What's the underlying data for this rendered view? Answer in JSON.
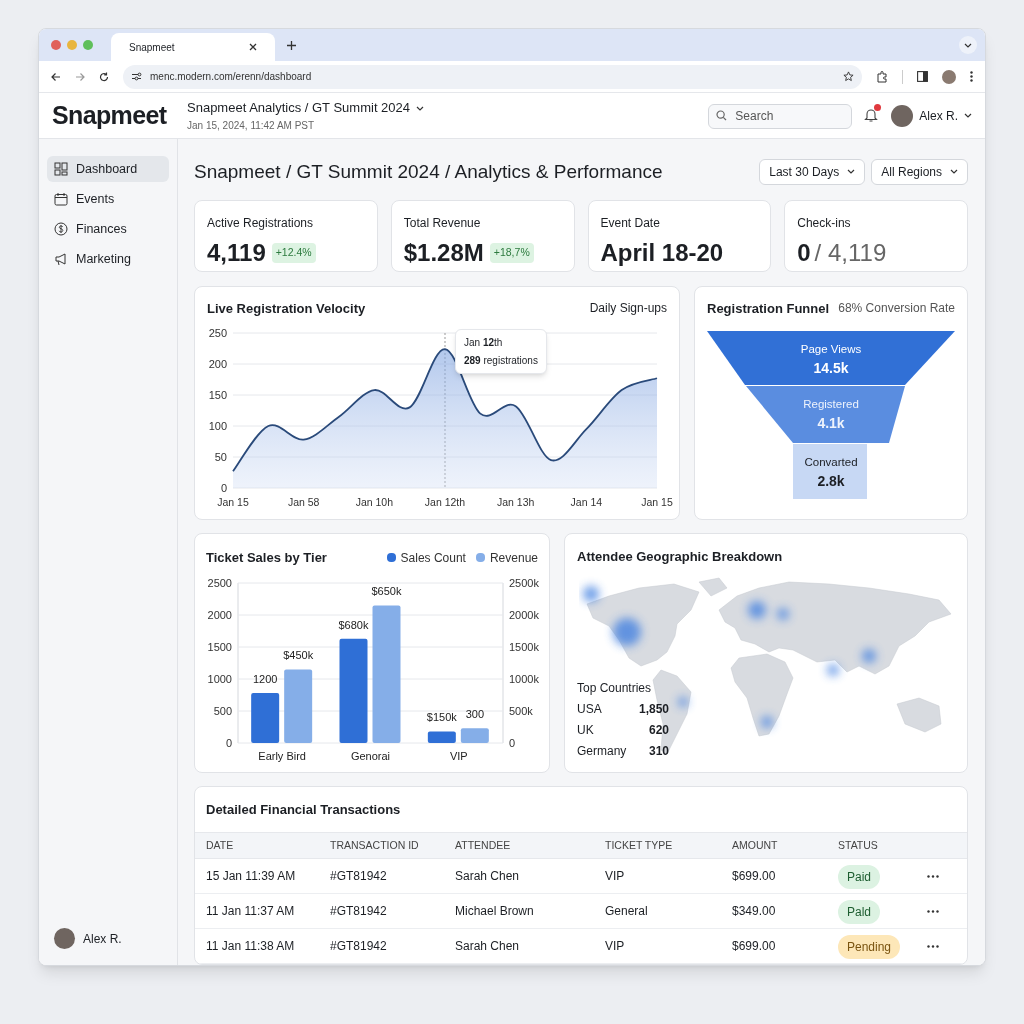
{
  "browser": {
    "tab_title": "Snapmeet",
    "url": "menc.modern.com/erenn/dashboard"
  },
  "header": {
    "logo": "Snapmeet",
    "breadcrumb": "Snapmeet Analytics / GT Summit 2024",
    "timestamp": "Jan 15, 2024, 11:42 AM PST",
    "search": {
      "placeholder": "Search"
    },
    "notifications": true,
    "user": "Alex R."
  },
  "sidebar": {
    "items": [
      {
        "label": "Dashboard",
        "selected": true
      },
      {
        "label": "Events",
        "selected": false
      },
      {
        "label": "Finances",
        "selected": false
      },
      {
        "label": "Marketing",
        "selected": false
      }
    ],
    "user": "Alex R."
  },
  "page": {
    "title": "Snapmeet / GT Summit 2024 / Analytics & Performance",
    "filters": [
      "Last 30 Days",
      "All Regions"
    ]
  },
  "stats": [
    {
      "label": "Active Registrations",
      "value": "4,119",
      "change": "+12.4%"
    },
    {
      "label": "Total Revenue",
      "value": "$1.28M",
      "change": "+18,7%"
    },
    {
      "label": "Event Date",
      "value": "April 18-20"
    },
    {
      "label": "Check-ins",
      "value": "0",
      "total": "/ 4,119"
    }
  ],
  "velocity": {
    "title": "Live Registration Velocity",
    "tooltip": {
      "date": "Jan **12**th",
      "text": "**289** registrations"
    },
    "chart_data": {
      "type": "area",
      "categories": [
        "Jan 15",
        null,
        "Jan 58",
        null,
        "Jan 10h",
        null,
        "Jan 12th",
        null,
        "Jan 13h",
        null,
        "Jan 14",
        null,
        "Jan 15"
      ],
      "series": [
        {
          "name": "Daily Sign-ups",
          "color": "#2a4a7a",
          "values": [
            27,
            100,
            78,
            115,
            158,
            130,
            224,
            120,
            132,
            45,
            95,
            158,
            177
          ]
        }
      ],
      "ylim": [
        0,
        250
      ],
      "grid": true,
      "ref_lines": [
        {
          "axis": "x",
          "value": "Jan 12th"
        }
      ],
      "yticks": [
        0,
        50,
        100,
        150,
        200,
        250
      ]
    }
  },
  "funnel": {
    "title": "Registration Funnel",
    "subtitle": "68% Conversion Rate",
    "stages": [
      {
        "label": "Page Views",
        "value": "14.5k"
      },
      {
        "label": "Registered",
        "value": "4.1k"
      },
      {
        "label": "Convarted",
        "value": "2.8k"
      }
    ]
  },
  "tiers": {
    "title": "Ticket Sales by Tier",
    "chart_data": {
      "type": "bar",
      "categories": [
        "Early Bird",
        "Genorai",
        "VIP"
      ],
      "series": [
        {
          "name": "Sales Count",
          "color": "#2f6fd6",
          "values": [
            780,
            1630,
            180
          ]
        },
        {
          "name": "Revenue",
          "color": "#85aee8",
          "values": [
            1150,
            2150,
            230
          ]
        }
      ],
      "ylim": [
        0,
        2500
      ],
      "y2lim": [
        0,
        2500
      ],
      "grid": true,
      "yticks": [
        0,
        500,
        1000,
        1500,
        2000,
        2500
      ],
      "y2ticks": [
        {
          "value": 0,
          "label": "0"
        },
        {
          "value": 500,
          "label": "500k"
        },
        {
          "value": 1000,
          "label": "1000k"
        },
        {
          "value": 1500,
          "label": "1500k"
        },
        {
          "value": 2000,
          "label": "2000k"
        },
        {
          "value": 2500,
          "label": "2500k"
        }
      ],
      "value_labels": [
        [
          "1200",
          "$680k",
          "$150k"
        ],
        [
          "$450k",
          "$650k",
          "300"
        ]
      ]
    }
  },
  "geo": {
    "title": "Attendee Geographic Breakdown",
    "list_title": "Top Countries",
    "countries": [
      {
        "name": "USA",
        "count": "1,850"
      },
      {
        "name": "UK",
        "count": "620"
      },
      {
        "name": "Germany",
        "count": "310"
      }
    ]
  },
  "transactions": {
    "title": "Detailed Financial Transactions",
    "columns": [
      "DATE",
      "TRANSACTION ID",
      "ATTENDEE",
      "TICKET TYPE",
      "AMOUNT",
      "STATUS"
    ],
    "rows": [
      {
        "date": "15 Jan 11:39 AM",
        "id": "#GT81942",
        "attendee": "Sarah Chen",
        "ticket": "VIP",
        "amount": "$699.00",
        "status": "Paid",
        "kind": "paid"
      },
      {
        "date": "11 Jan 11:37 AM",
        "id": "#GT81942",
        "attendee": "Michael Brown",
        "ticket": "General",
        "amount": "$349.00",
        "status": "Pald",
        "kind": "paid"
      },
      {
        "date": "11 Jan 11:38 AM",
        "id": "#GT81942",
        "attendee": "Sarah Chen",
        "ticket": "VIP",
        "amount": "$699.00",
        "status": "Pending",
        "kind": "pending"
      }
    ]
  }
}
